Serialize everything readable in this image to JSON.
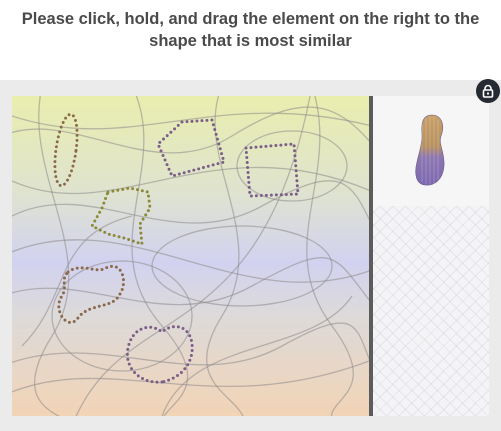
{
  "instruction": {
    "line1": "Please click, hold, and drag the element on the right to the",
    "line2": "shape that is most similar"
  },
  "icons": {
    "lock": "lock-icon",
    "piece": "peanut-shape"
  },
  "colors": {
    "lock_bg": "#262b33",
    "divider": "#5c5c5c",
    "dot_purple": "#7b5f88",
    "dot_brown": "#8a6a4a",
    "dot_olive": "#8b8a3a",
    "piece_top": "#c9a06a",
    "piece_bottom": "#7c68b0"
  }
}
